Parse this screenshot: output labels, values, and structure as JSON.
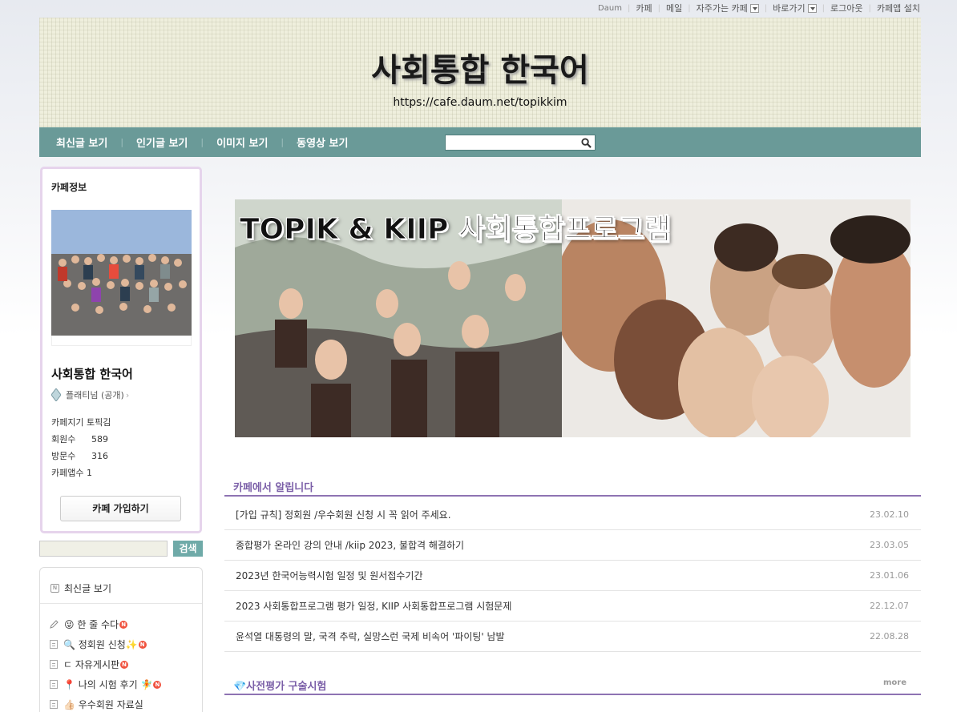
{
  "gnb": {
    "brand": "Daum",
    "items": [
      "카페",
      "메일",
      "자주가는 카페",
      "바로가기",
      "로그아웃",
      "카페앱 설치"
    ]
  },
  "header": {
    "title": "사회통합 한국어",
    "url": "https://cafe.daum.net/topikkim"
  },
  "menu": {
    "items": [
      "최신글 보기",
      "인기글 보기",
      "이미지 보기",
      "동영상 보기"
    ],
    "search_placeholder": ""
  },
  "cafe_info": {
    "heading": "카페정보",
    "name": "사회통합 한국어",
    "grade": "플래티넘 (공개)",
    "stats": [
      {
        "label": "카페지기",
        "value": "토픽김"
      },
      {
        "label": "회원수",
        "value": "589"
      },
      {
        "label": "방문수",
        "value": "316"
      },
      {
        "label": "카페앱수",
        "value": "1"
      }
    ],
    "join_label": "카페 가입하기"
  },
  "side_search": {
    "button_label": "검색"
  },
  "boards": {
    "recent_label": "최신글 보기",
    "items": [
      {
        "label": "😜 한 줄 수다",
        "new": true
      },
      {
        "label": "🔍 정회원 신청✨",
        "new": true
      },
      {
        "label": "ㄷ 자유게시판",
        "new": true
      },
      {
        "label": "📍 나의 시험 후기 🧚",
        "new": true
      },
      {
        "label": "👍🏻 우수회원 자료실",
        "new": false
      }
    ]
  },
  "banner": {
    "title": "TOPIK & KIIP 사회통합프로그램"
  },
  "notice": {
    "title": "카페에서 알립니다",
    "items": [
      {
        "title": "[가입 규칙] 정회원 /우수회원 신청 시 꼭 읽어 주세요.",
        "date": "23.02.10"
      },
      {
        "title": "종합평가 온라인 강의 안내 /kiip 2023, 불합격 해결하기",
        "date": "23.03.05"
      },
      {
        "title": "2023년 한국어능력시험 일정 및 원서접수기간",
        "date": "23.01.06"
      },
      {
        "title": "2023 사회통합프로그램 평가 일정, KIIP 사회통합프로그램 시험문제",
        "date": "22.12.07"
      },
      {
        "title": "윤석열 대통령의 말, 국격 추락, 실망스런 국제 비속어 '파이팅' 남발",
        "date": "22.08.28"
      }
    ]
  },
  "section2": {
    "title": "💎사전평가 구술시험",
    "more": "more"
  }
}
